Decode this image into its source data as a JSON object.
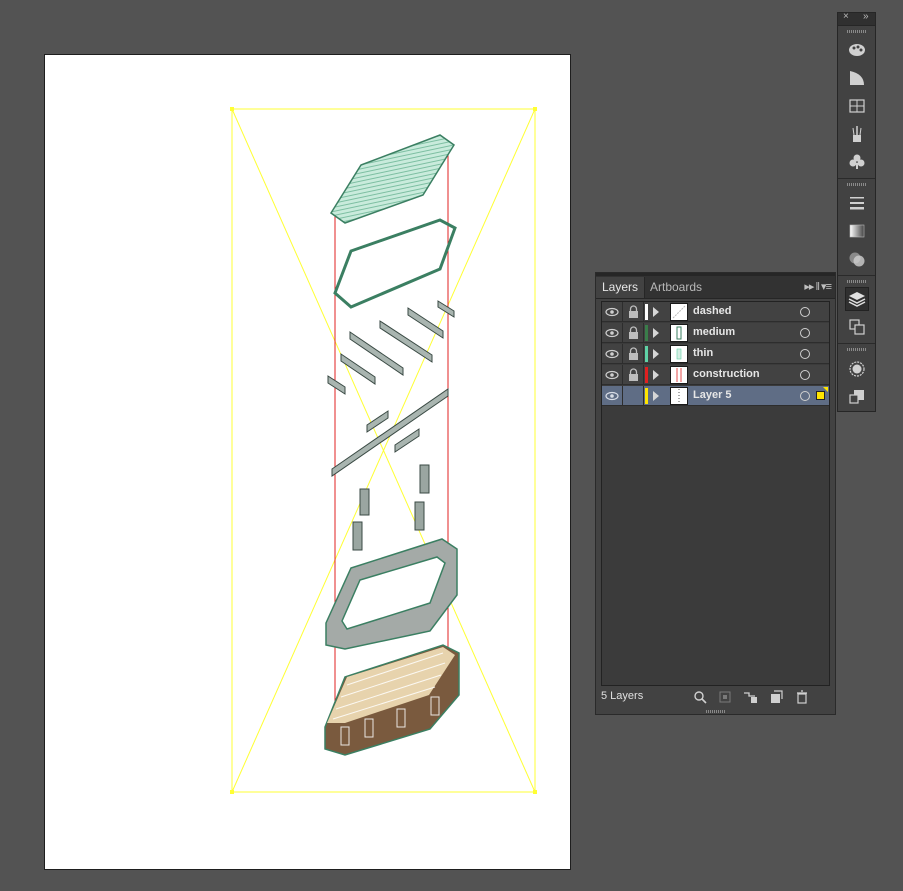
{
  "layers_panel": {
    "tabs": [
      "Layers",
      "Artboards"
    ],
    "layers": [
      {
        "name": "dashed",
        "color": "#ffffff",
        "locked": true,
        "visible": true,
        "selected": false
      },
      {
        "name": "medium",
        "color": "#3a7d4a",
        "locked": true,
        "visible": true,
        "selected": false
      },
      {
        "name": "thin",
        "color": "#5fd2a6",
        "locked": true,
        "visible": true,
        "selected": false
      },
      {
        "name": "construction",
        "color": "#e02020",
        "locked": true,
        "visible": true,
        "selected": false
      },
      {
        "name": "Layer 5",
        "color": "#ffe500",
        "locked": false,
        "visible": true,
        "selected": true
      }
    ],
    "count_label": "5 Layers",
    "footer_icons": [
      "locate-object-icon",
      "make-clipping-mask-icon",
      "create-sublayer-icon",
      "new-layer-icon",
      "delete-icon"
    ]
  },
  "dock": {
    "icons": [
      "color-guide-icon",
      "color-icon",
      "swatches-icon",
      "brushes-icon",
      "symbols-icon",
      "stroke-icon",
      "gradient-icon",
      "transparency-icon",
      "layers-icon",
      "artboards-icon",
      "appearance-icon",
      "graphic-styles-icon"
    ]
  },
  "colors": {
    "canvas_bg": "#535353",
    "guide_yellow": "#ffff33",
    "construction_red": "#e02020",
    "artwork_green": "#3b7f62",
    "mint": "#bfe5d4"
  }
}
